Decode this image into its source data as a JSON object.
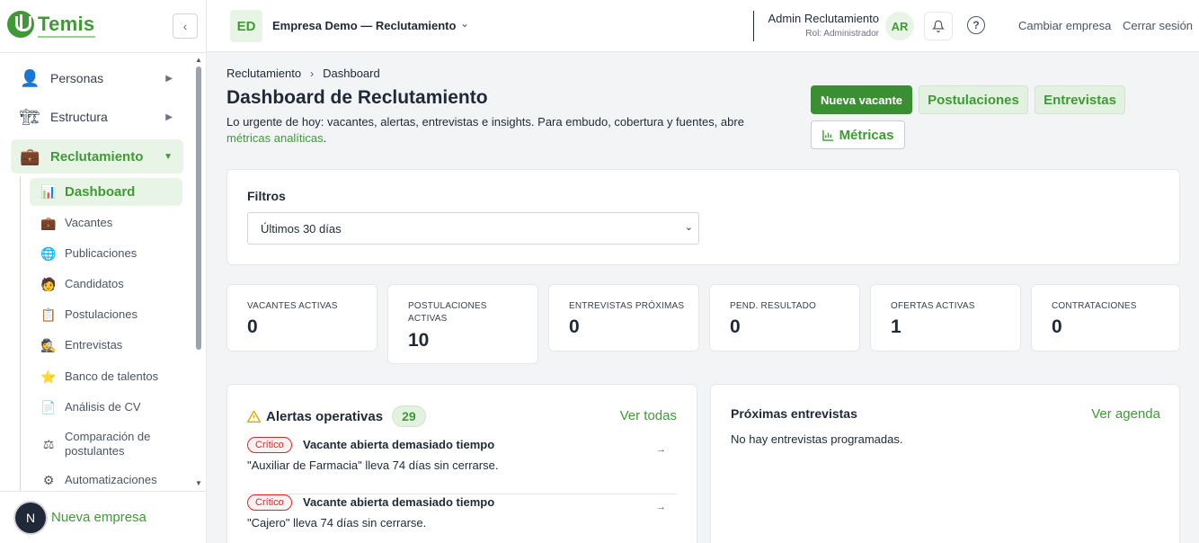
{
  "brand": {
    "name": "Temis"
  },
  "sidebar": {
    "collapse_icon": "chevron-left-icon",
    "top_items": [
      {
        "label": "Personas",
        "icon": "person-icon"
      },
      {
        "label": "Estructura",
        "icon": "building-icon"
      },
      {
        "label": "Reclutamiento",
        "icon": "briefcase-icon",
        "active": true
      }
    ],
    "sub_items": [
      {
        "label": "Dashboard",
        "icon": "chart-icon",
        "active": true
      },
      {
        "label": "Vacantes",
        "icon": "briefcase-icon"
      },
      {
        "label": "Publicaciones",
        "icon": "globe-icon"
      },
      {
        "label": "Candidatos",
        "icon": "face-icon"
      },
      {
        "label": "Postulaciones",
        "icon": "clipboard-icon"
      },
      {
        "label": "Entrevistas",
        "icon": "interviewer-icon"
      },
      {
        "label": "Banco de talentos",
        "icon": "star-icon"
      },
      {
        "label": "Análisis de CV",
        "icon": "document-icon"
      },
      {
        "label": "Comparación de postulantes",
        "icon": "scale-icon"
      },
      {
        "label": "Automatizaciones",
        "icon": "gear-icon"
      }
    ],
    "footer": {
      "avatar_letter": "N",
      "label": "Nueva empresa"
    }
  },
  "topbar": {
    "company_initials": "ED",
    "company_name": "Empresa Demo — Reclutamiento",
    "user_name": "Admin Reclutamiento",
    "user_role": "Rol: Administrador",
    "user_initials": "AR",
    "change_company": "Cambiar empresa",
    "logout": "Cerrar sesión"
  },
  "breadcrumb": {
    "root": "Reclutamiento",
    "separator": "›",
    "current": "Dashboard"
  },
  "header": {
    "title": "Dashboard de Reclutamiento",
    "description": "Lo urgente de hoy: vacantes, alertas, entrevistas e insights. Para embudo, cobertura y fuentes, abre ",
    "description_link": "métricas analíticas",
    "description_end": "."
  },
  "actions": {
    "new_vacancy": "Nueva vacante",
    "applications": "Postulaciones",
    "interviews": "Entrevistas",
    "metrics": "Métricas"
  },
  "filters": {
    "title": "Filtros",
    "period_selected": "Últimos 30 días"
  },
  "kpis": [
    {
      "label": "Vacantes activas",
      "value": "0"
    },
    {
      "label": "Postulaciones activas",
      "value": "10"
    },
    {
      "label": "Entrevistas próximas",
      "value": "0"
    },
    {
      "label": "Pend. resultado",
      "value": "0"
    },
    {
      "label": "Ofertas activas",
      "value": "1"
    },
    {
      "label": "Contrataciones",
      "value": "0"
    }
  ],
  "alerts": {
    "title": "Alertas operativas",
    "count": "29",
    "view_all": "Ver todas",
    "items": [
      {
        "severity": "Crítico",
        "title": "Vacante abierta demasiado tiempo",
        "description": "\"Auxiliar de Farmacia\" lleva 74 días sin cerrarse.",
        "arrow": "→"
      },
      {
        "severity": "Crítico",
        "title": "Vacante abierta demasiado tiempo",
        "description": "\"Cajero\" lleva 74 días sin cerrarse.",
        "arrow": "→"
      }
    ]
  },
  "upcoming_interviews": {
    "title": "Próximas entrevistas",
    "link": "Ver agenda",
    "empty": "No hay entrevistas programadas."
  },
  "colors": {
    "accent": "#3f9a36",
    "critical": "#dc2626"
  }
}
